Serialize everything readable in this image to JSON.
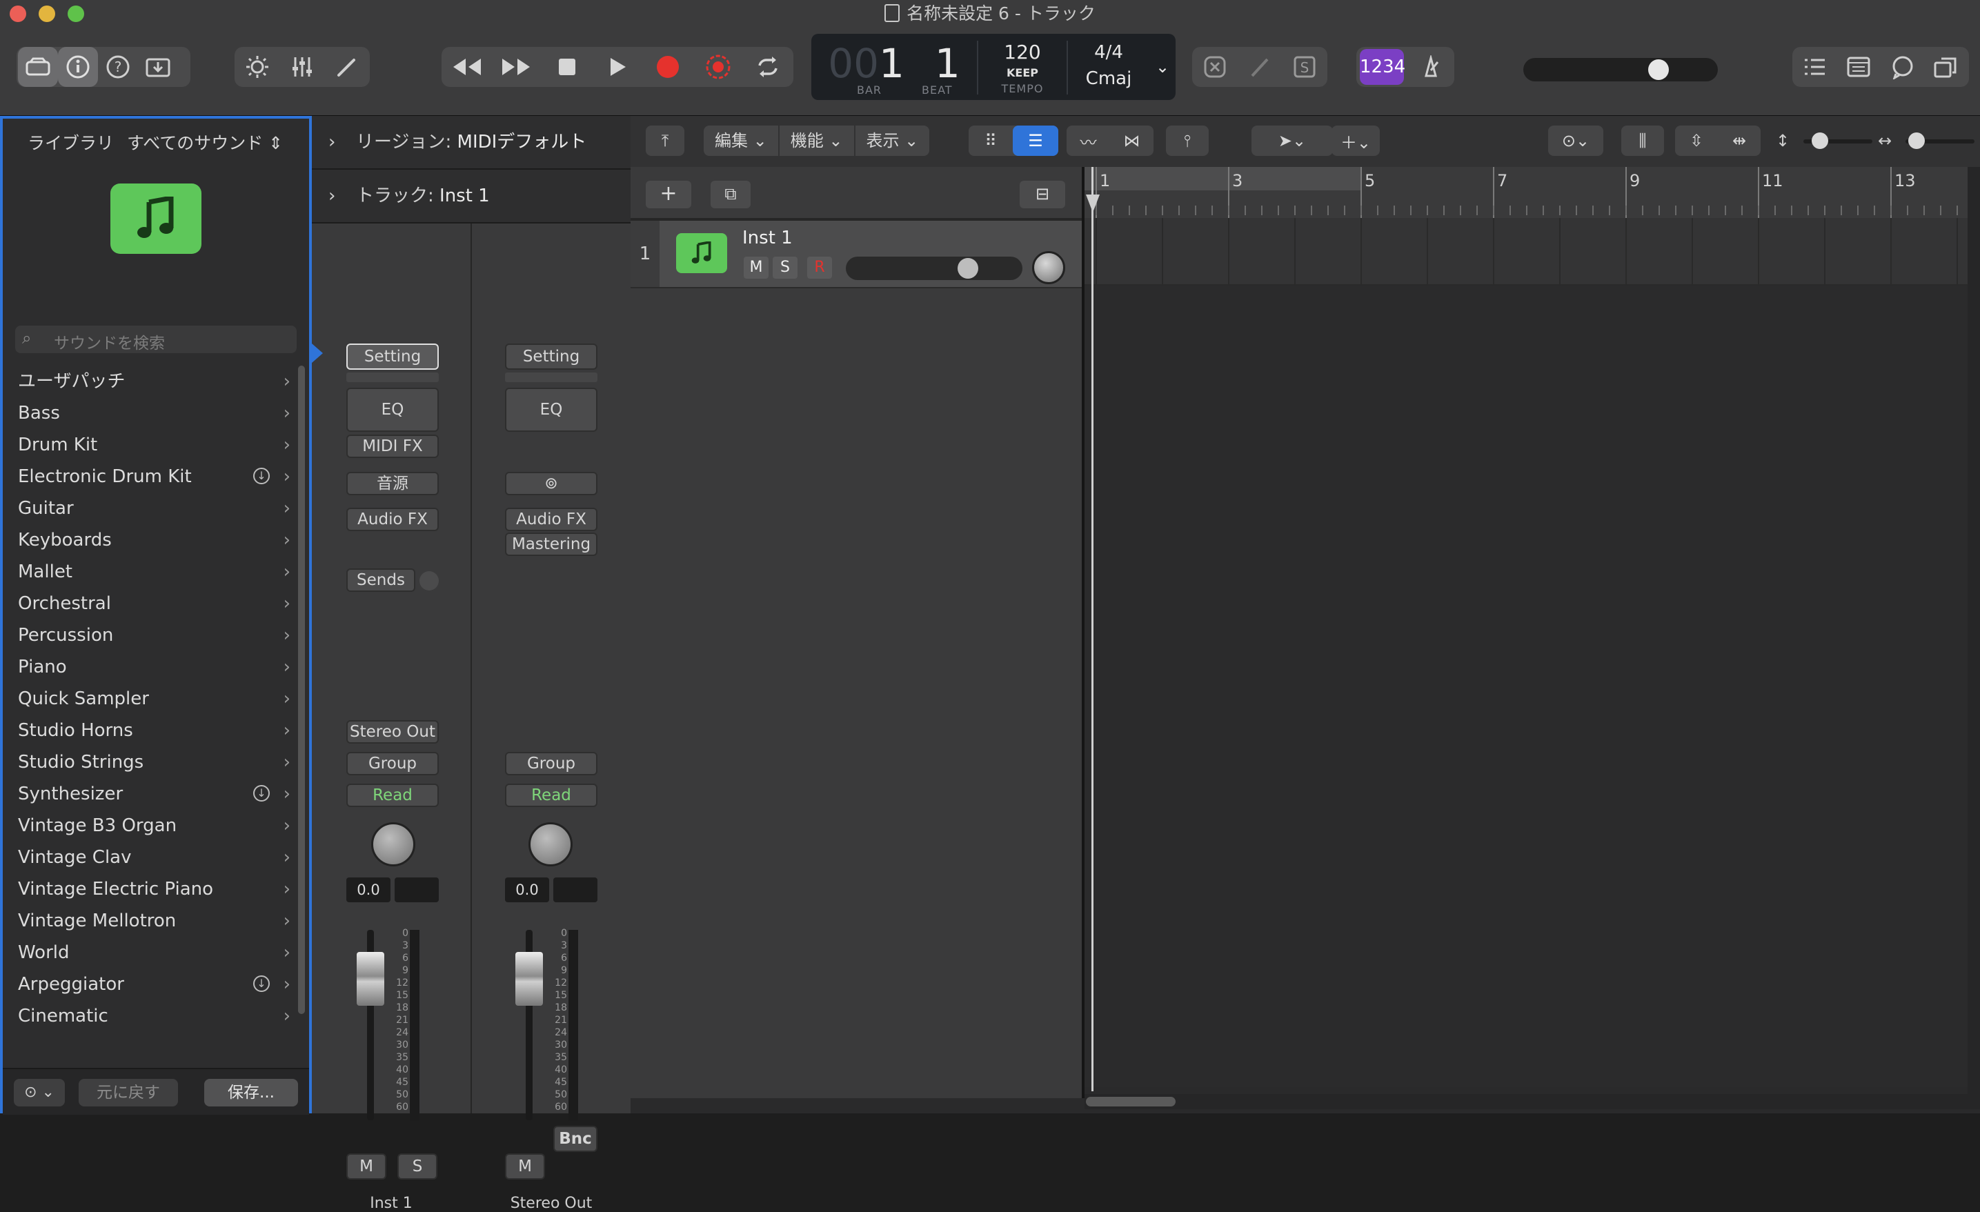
{
  "window": {
    "title": "名称未設定 6 - トラック"
  },
  "toolbar": {
    "left_icons": [
      "library-icon",
      "info-icon",
      "help-icon",
      "download-icon"
    ],
    "mid_icons": [
      "brightness-icon",
      "mixer-icon",
      "pencil-icon"
    ],
    "transport_icons": [
      "rewind-icon",
      "fast-forward-icon",
      "stop-icon",
      "play-icon",
      "record-icon",
      "capture-record-icon",
      "cycle-icon"
    ],
    "lcd": {
      "bar": "1",
      "bar_prefix": "00",
      "bar_label": "BAR",
      "beat": "1",
      "beat_label": "BEAT",
      "tempo": "120",
      "tempo_mode": "KEEP",
      "tempo_label": "TEMPO",
      "time_signature": "4/4",
      "key": "Cmaj"
    },
    "count_in": "1234",
    "master_volume": 0.72,
    "colors": {
      "record": "#e5322d",
      "count_in_bg": "#7b3fc4",
      "accent": "#2f74d9",
      "track_icon": "#5ec75a",
      "read": "#7fd67a"
    }
  },
  "library": {
    "title": "ライブラリ",
    "filter": "すべてのサウンド",
    "search_placeholder": "サウンドを検索",
    "items": [
      {
        "label": "ユーザパッチ",
        "download": false
      },
      {
        "label": "Bass",
        "download": false
      },
      {
        "label": "Drum Kit",
        "download": false
      },
      {
        "label": "Electronic Drum Kit",
        "download": true
      },
      {
        "label": "Guitar",
        "download": false
      },
      {
        "label": "Keyboards",
        "download": false
      },
      {
        "label": "Mallet",
        "download": false
      },
      {
        "label": "Orchestral",
        "download": false
      },
      {
        "label": "Percussion",
        "download": false
      },
      {
        "label": "Piano",
        "download": false
      },
      {
        "label": "Quick Sampler",
        "download": false
      },
      {
        "label": "Studio Horns",
        "download": false
      },
      {
        "label": "Studio Strings",
        "download": false
      },
      {
        "label": "Synthesizer",
        "download": true
      },
      {
        "label": "Vintage B3 Organ",
        "download": false
      },
      {
        "label": "Vintage Clav",
        "download": false
      },
      {
        "label": "Vintage Electric Piano",
        "download": false
      },
      {
        "label": "Vintage Mellotron",
        "download": false
      },
      {
        "label": "World",
        "download": false
      },
      {
        "label": "Arpeggiator",
        "download": true
      },
      {
        "label": "Cinematic",
        "download": false
      }
    ],
    "revert_label": "元に戻す",
    "save_label": "保存..."
  },
  "inspector": {
    "region_label": "リージョン:",
    "region_value": "MIDIデフォルト",
    "track_label": "トラック:",
    "track_value": "Inst 1",
    "strip1": {
      "setting": "Setting",
      "eq": "EQ",
      "midi_fx": "MIDI FX",
      "instrument": "音源",
      "audio_fx": "Audio FX",
      "sends": "Sends",
      "output": "Stereo Out",
      "group": "Group",
      "automation": "Read",
      "volume": "0.0",
      "mute": "M",
      "solo": "S",
      "name": "Inst 1"
    },
    "strip2": {
      "setting": "Setting",
      "eq": "EQ",
      "audio_fx": "Audio FX",
      "audio_fx_plugin": "Mastering",
      "group": "Group",
      "automation": "Read",
      "volume": "0.0",
      "mute": "M",
      "bounce": "Bnc",
      "name": "Stereo Out"
    },
    "meter_scale": [
      "0",
      "3",
      "6",
      "9",
      "12",
      "15",
      "18",
      "21",
      "24",
      "30",
      "35",
      "40",
      "45",
      "50",
      "60"
    ]
  },
  "tracks_toolbar": {
    "edit": "編集",
    "functions": "機能",
    "view": "表示"
  },
  "tracks": [
    {
      "number": "1",
      "name": "Inst 1",
      "mute": "M",
      "solo": "S",
      "record": "R",
      "volume": 0.72
    }
  ],
  "ruler": {
    "bars": [
      "1",
      "3",
      "5",
      "7",
      "9",
      "11",
      "13"
    ]
  }
}
